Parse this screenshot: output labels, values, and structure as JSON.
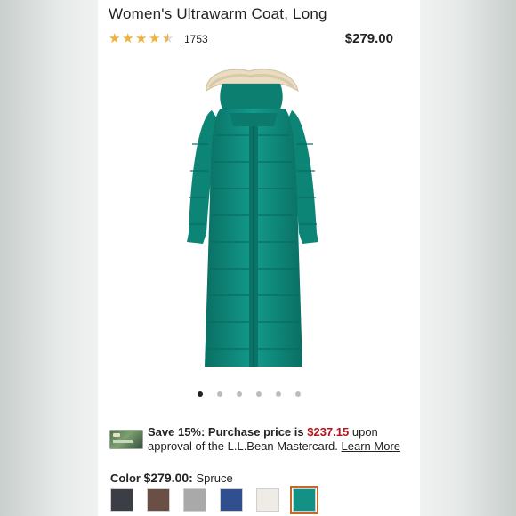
{
  "product": {
    "title": "Women's Ultrawarm Coat, Long",
    "rating": 4.5,
    "review_count": "1753",
    "price": "$279.00"
  },
  "gallery": {
    "image_count": 6,
    "active_index": 0,
    "coat_color": "#0e8c7c",
    "fur_color": "#e9dcc0"
  },
  "promo": {
    "line1_bold": "Save 15%: Purchase price is",
    "sale_price": "$237.15",
    "line1_end": "upon",
    "line2": "approval of the L.L.Bean Mastercard.",
    "learn_more": "Learn More",
    "sale_color": "#b5121b"
  },
  "color_selector": {
    "label": "Color",
    "price": "$279.00:",
    "selected_name": "Spruce",
    "swatches": [
      {
        "name": "charcoal",
        "color": "#3b3f45"
      },
      {
        "name": "brown",
        "color": "#6b4f45"
      },
      {
        "name": "gray-heather",
        "color": "#a9a9a9"
      },
      {
        "name": "navy-blue",
        "color": "#2f4f8f"
      },
      {
        "name": "cream",
        "color": "#efece6"
      },
      {
        "name": "spruce",
        "color": "#129184",
        "selected": true
      }
    ]
  },
  "accents": {
    "star": "#f3b23a",
    "selected_outline": "#c26a2a"
  }
}
